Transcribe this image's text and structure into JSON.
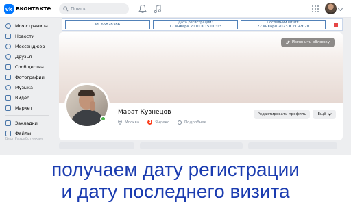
{
  "header": {
    "logo_text": "вконтакте",
    "logo_mark": "vk",
    "search_placeholder": "Поиск",
    "icons": [
      "search-icon",
      "bell-icon",
      "music-icon",
      "apps-icon",
      "avatar",
      "chevron-down-icon"
    ]
  },
  "sidebar": {
    "items": [
      {
        "label": "Моя страница",
        "icon": "home-icon"
      },
      {
        "label": "Новости",
        "icon": "news-icon"
      },
      {
        "label": "Мессенджер",
        "icon": "chat-icon"
      },
      {
        "label": "Друзья",
        "icon": "friends-icon"
      },
      {
        "label": "Сообщества",
        "icon": "groups-icon"
      },
      {
        "label": "Фотографии",
        "icon": "photo-icon"
      },
      {
        "label": "Музыка",
        "icon": "music-icon"
      },
      {
        "label": "Видео",
        "icon": "video-icon"
      },
      {
        "label": "Маркет",
        "icon": "market-icon"
      }
    ],
    "items_secondary": [
      {
        "label": "Закладки",
        "icon": "bookmark-icon"
      },
      {
        "label": "Файлы",
        "icon": "file-icon"
      }
    ],
    "footer": "Блог  Разработчикам"
  },
  "info_bar": {
    "id_text": "id: 65828386",
    "reg_label": "Дата регистрации:",
    "reg_value": "17 января 2010 в 15:00:03",
    "last_label": "Последний визит:",
    "last_value": "22 января 2023 в 21:49:20",
    "marker_color": "#e64646"
  },
  "profile": {
    "cover_button": "Изменить обложку",
    "name": "Марат Кузнецов",
    "city": "Москва",
    "work": "Яндекс",
    "details": "Подробнее",
    "edit_button": "Редактировать профиль",
    "more_button": "Ещё",
    "online": true
  },
  "caption": {
    "line1": "получаем дату регистрации",
    "line2": "и дату последнего визита",
    "color": "#1b3cb0"
  }
}
